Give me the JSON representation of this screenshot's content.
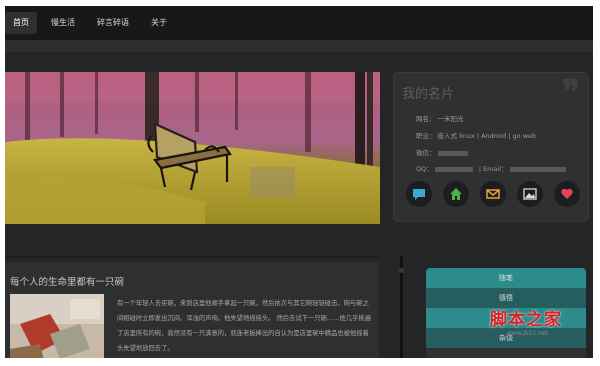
{
  "nav": {
    "items": [
      {
        "label": "首页",
        "active": true
      },
      {
        "label": "慢生活",
        "active": false
      },
      {
        "label": "碎言碎语",
        "active": false
      },
      {
        "label": "关于",
        "active": false
      }
    ]
  },
  "card": {
    "title": "我的名片",
    "quote_mark": "❞",
    "name_label": "网名：",
    "name_value": "一米阳光",
    "job_label": "职业：",
    "job_value": "嵌入式 linux | Android | go web",
    "wechat_label": "微信：",
    "qq_label": "QQ：",
    "email_label": "| Email：",
    "icons": [
      "chat-icon",
      "home-icon",
      "mail-icon",
      "picture-icon",
      "heart-icon"
    ]
  },
  "article": {
    "title": "每个人的生命里都有一只碗",
    "text": "有一个年轻人去买碗，来到店里他顺手拿起一只碗，然后依次与其它碗轻轻碰击，碗与碗之间相碰时立即发出沉闷、浑浊的声响，他失望地摇摇头。 然后去试下一只碗……他几乎挑遍了店里所有的碗，竟然没有一只满意的，就连老板捧出的自认为是店里碗中精品也被他摇着头失望地放回去了。"
  },
  "sidemenu": {
    "items": [
      "随笔",
      "感悟",
      "",
      "杂谈"
    ]
  },
  "watermark": {
    "text": "脚本之家",
    "url": "www.jb51.net"
  },
  "colors": {
    "teal": "#2c8b8b",
    "dark_teal": "#265e60",
    "background": "#242526",
    "icon_chat": "#3aa7d8",
    "icon_home": "#4cae4c",
    "icon_mail": "#e8a33d",
    "icon_picture": "#d8d8d8",
    "icon_heart": "#e8415b"
  }
}
